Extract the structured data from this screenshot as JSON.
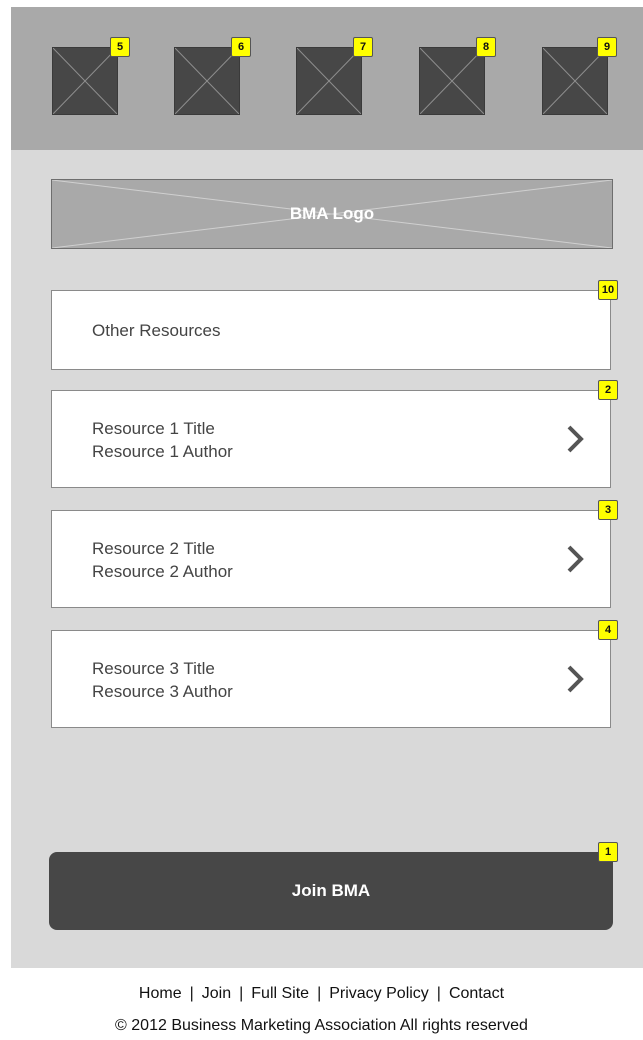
{
  "top_icons": [
    {
      "name": "image-placeholder-icon",
      "badge": "5"
    },
    {
      "name": "image-placeholder-icon",
      "badge": "6"
    },
    {
      "name": "image-placeholder-icon",
      "badge": "7"
    },
    {
      "name": "image-placeholder-icon",
      "badge": "8"
    },
    {
      "name": "image-placeholder-icon",
      "badge": "9"
    }
  ],
  "logo": {
    "label": "BMA Logo"
  },
  "other_resources": {
    "label": "Other Resources",
    "badge": "10"
  },
  "resources": [
    {
      "title": "Resource 1 Title",
      "author": "Resource 1 Author",
      "badge": "2",
      "icon": "chevron-right-icon"
    },
    {
      "title": "Resource 2 Title",
      "author": "Resource 2 Author",
      "badge": "3",
      "icon": "chevron-right-icon"
    },
    {
      "title": "Resource 3 Title",
      "author": "Resource 3 Author",
      "badge": "4",
      "icon": "chevron-right-icon"
    }
  ],
  "join_button": {
    "label": "Join BMA",
    "badge": "1"
  },
  "footer": {
    "links": [
      "Home",
      "Join",
      "Full Site",
      "Privacy Policy",
      "Contact"
    ],
    "separator": "|",
    "copyright": "© 2012 Business Marketing Association All rights reserved"
  },
  "colors": {
    "topbar": "#a9a9a9",
    "panel": "#d9d9d9",
    "dark": "#474747",
    "badge": "#ffff00"
  }
}
